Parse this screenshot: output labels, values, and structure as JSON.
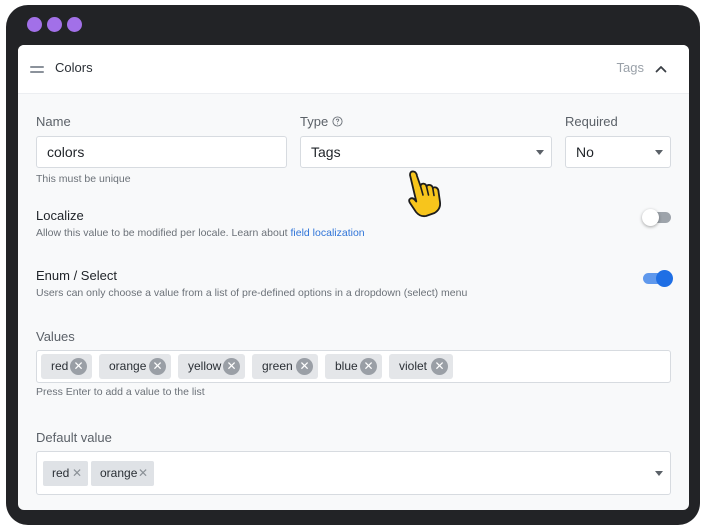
{
  "window": {
    "title": "Colors",
    "type_tag": "Tags",
    "dot_color": "#a270e8"
  },
  "name_field": {
    "label": "Name",
    "value": "colors",
    "help": "This must be unique"
  },
  "type_field": {
    "label": "Type",
    "value": "Tags"
  },
  "required_field": {
    "label": "Required",
    "value": "No"
  },
  "localize": {
    "title": "Localize",
    "help_prefix": "Allow this value to be modified per locale. Learn about ",
    "help_link": "field localization",
    "enabled": false
  },
  "enum": {
    "title": "Enum / Select",
    "help": "Users can only choose a value from a list of pre-defined options in a dropdown (select) menu",
    "enabled": true
  },
  "values": {
    "label": "Values",
    "items": [
      "red",
      "orange",
      "yellow",
      "green",
      "blue",
      "violet"
    ],
    "help": "Press Enter to add a value to the list"
  },
  "default_value": {
    "label": "Default value",
    "items": [
      "red",
      "orange"
    ]
  },
  "accent_color": "#1f6fe5",
  "link_color": "#2f74d8"
}
